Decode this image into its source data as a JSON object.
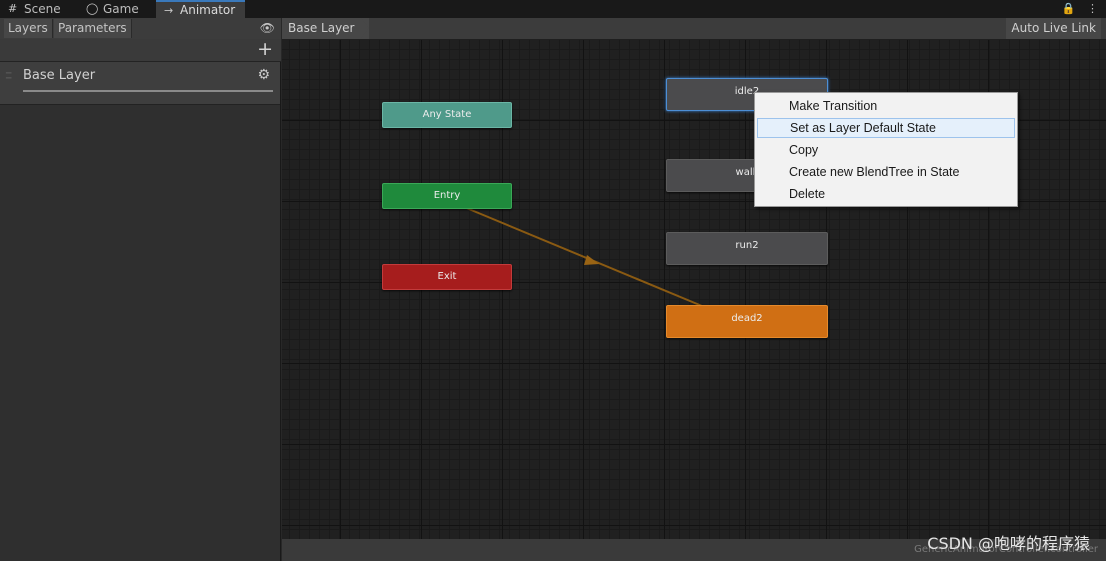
{
  "tabs": [
    {
      "label": "Scene",
      "icon": "grid-icon"
    },
    {
      "label": "Game",
      "icon": "gamepad-icon"
    },
    {
      "label": "Animator",
      "icon": "animator-icon"
    }
  ],
  "left_panel": {
    "tabs": [
      "Layers",
      "Parameters"
    ],
    "layer_name": "Base Layer"
  },
  "graph": {
    "breadcrumb": "Base Layer",
    "live_link": "Auto Live Link",
    "controller_name": "GenericAnimatorController.controller"
  },
  "nodes": {
    "any_state": "Any State",
    "entry": "Entry",
    "exit": "Exit",
    "idle": "idle2",
    "walk": "walk",
    "run": "run2",
    "dead": "dead2"
  },
  "context_menu": {
    "items": [
      "Make Transition",
      "Set as Layer Default State",
      "Copy",
      "Create new BlendTree in State",
      "Delete"
    ],
    "highlighted_index": 1
  },
  "watermark": "CSDN @咆哮的程序猿",
  "colors": {
    "accent": "#3a79bb",
    "entry": "#1f8a3c",
    "exit": "#a61d1d",
    "any_state": "#4f9a8a",
    "default_state": "#d06f14",
    "transition": "#8a5a12"
  }
}
